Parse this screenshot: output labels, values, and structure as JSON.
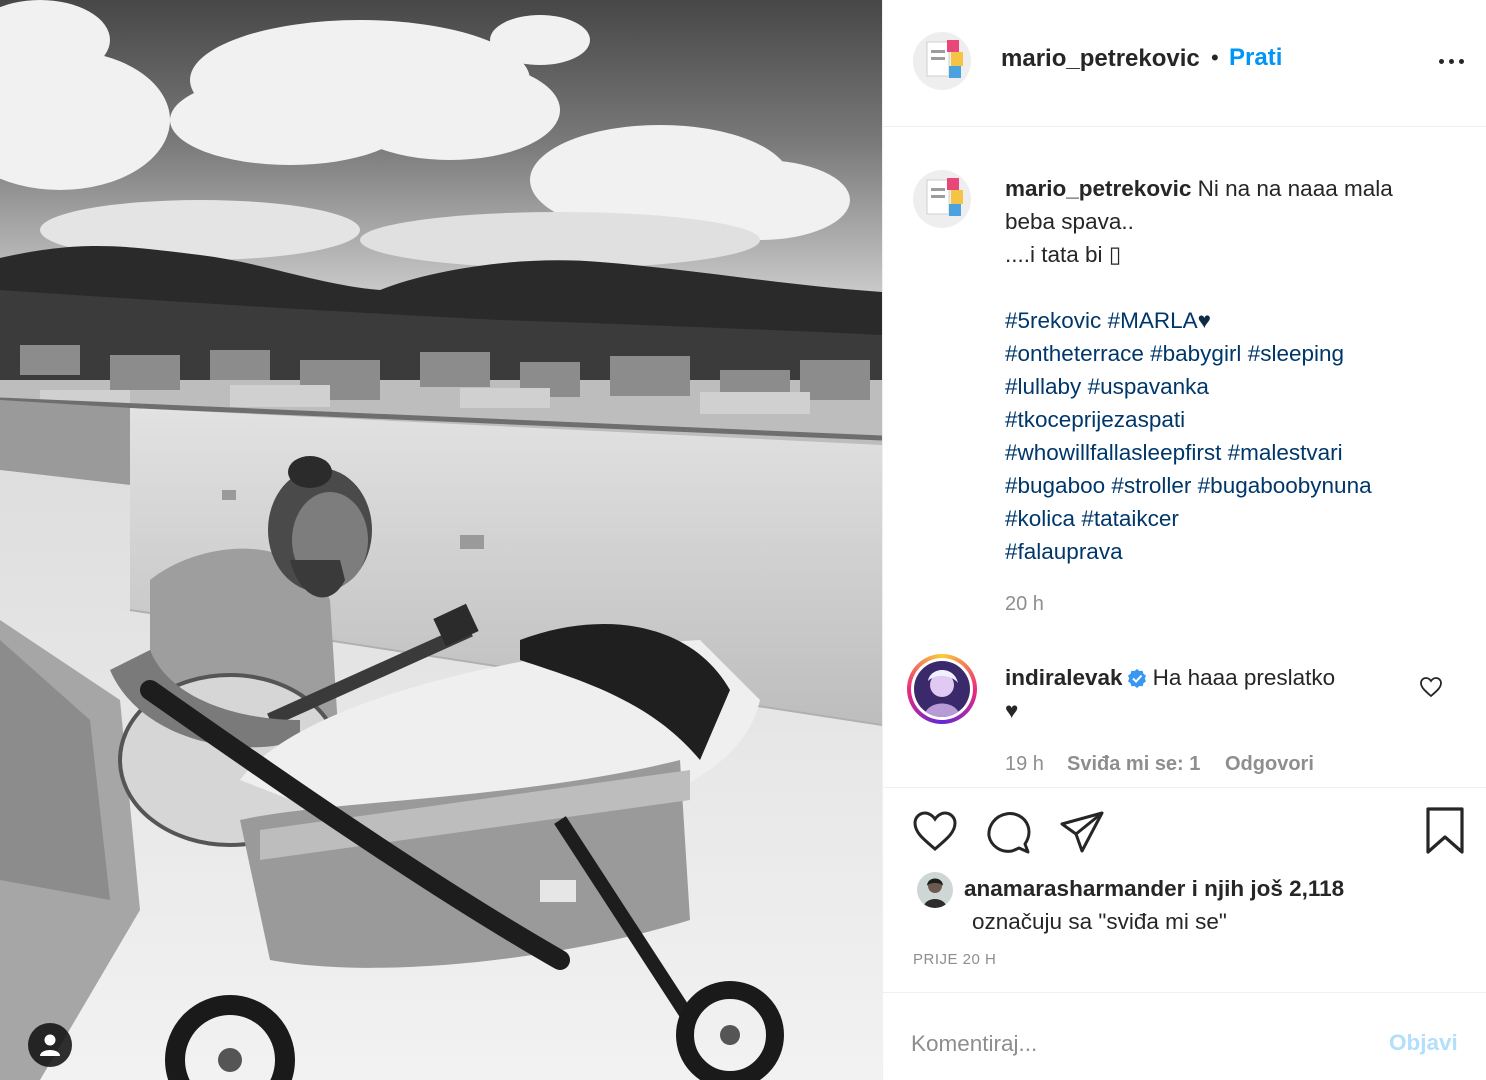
{
  "post": {
    "username": "mario_petrekovic",
    "dot": "•",
    "follow_label": "Prati",
    "more_label": "More options"
  },
  "caption": {
    "username": "mario_petrekovic",
    "line1": "Ni na na naaa mala",
    "line2": "beba spava..",
    "line3": "....i tata bi ",
    "line3_glyph": "▯",
    "hashtags": [
      [
        "#5rekovic",
        "#MARLA"
      ],
      [
        "#ontheterrace",
        "#babygirl",
        "#sleeping"
      ],
      [
        "#lullaby",
        "#uspavanka"
      ],
      [
        "#tkoceprijezaspati"
      ],
      [
        "#whowillfallasleepfirst",
        "#malestvari"
      ],
      [
        "#bugaboo",
        "#stroller",
        "#bugaboobynuna"
      ],
      [
        "#kolica",
        "#tataikcer"
      ],
      [
        "#falauprava"
      ]
    ],
    "heart_after_marla": "♥",
    "time": "20 h"
  },
  "comment": {
    "username": "indiralevak",
    "text": "Ha haaa preslatko",
    "text2": "♥",
    "time": "19 h",
    "likes": "Sviđa mi se: 1",
    "reply": "Odgovori"
  },
  "actions": {
    "like_icon": "heart-icon",
    "comment_icon": "comment-icon",
    "share_icon": "share-icon",
    "save_icon": "bookmark-icon"
  },
  "liked_by": {
    "username": "anamarasharmander",
    "rest": " i njih još 2,118",
    "line2": "označuju sa \"sviđa mi se\""
  },
  "posted": "PRIJE 20 H",
  "add_comment": {
    "placeholder": "Komentiraj...",
    "post_label": "Objavi"
  },
  "colors": {
    "link": "#0095f6",
    "hashtag": "#00376b",
    "muted": "#8e8e8e",
    "post_disabled": "#b2dffc"
  }
}
